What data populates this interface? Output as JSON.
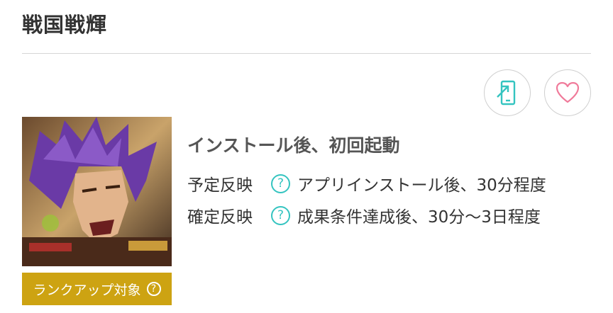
{
  "header": {
    "title": "戦国戦輝"
  },
  "actions": {
    "install_icon": "phone-install-icon",
    "favorite_icon": "heart-icon"
  },
  "thumbnail": {
    "description_icon": "game-character-thumbnail"
  },
  "rank_badge": {
    "label": "ランクアップ対象",
    "help": "?"
  },
  "condition": {
    "title": "インストール後、初回起動",
    "rows": [
      {
        "label": "予定反映",
        "help": "?",
        "value": "アプリインストール後、30分程度"
      },
      {
        "label": "確定反映",
        "help": "?",
        "value": "成果条件達成後、30分〜3日程度"
      }
    ]
  },
  "colors": {
    "accent": "#34c4c0",
    "heart": "#f07a9a",
    "badge": "#cda312"
  }
}
